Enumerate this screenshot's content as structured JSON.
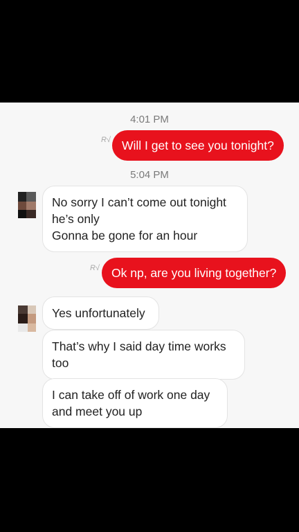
{
  "conversation": {
    "time_1": "4:01 PM",
    "time_2": "5:04 PM",
    "messages": [
      {
        "direction": "outgoing",
        "text": "Will I get to see you tonight?"
      },
      {
        "direction": "incoming",
        "lines": [
          "No sorry I can’t come out tonight",
          "he’s only",
          "Gonna be gone for an hour"
        ]
      },
      {
        "direction": "outgoing",
        "text": "Ok np, are you living together?"
      },
      {
        "direction": "incoming",
        "lines": [
          "Yes unfortunately"
        ]
      },
      {
        "direction": "incoming",
        "lines": [
          "That’s why I said day time works",
          "too"
        ]
      },
      {
        "direction": "incoming",
        "lines": [
          "I can take off of work one day",
          "and meet you up"
        ]
      }
    ],
    "read_receipt_icon": "read-receipt-icon"
  },
  "colors": {
    "outgoing_bubble": "#e8121d",
    "incoming_bubble": "#ffffff",
    "background": "#f7f7f7",
    "letterbox": "#000000"
  }
}
